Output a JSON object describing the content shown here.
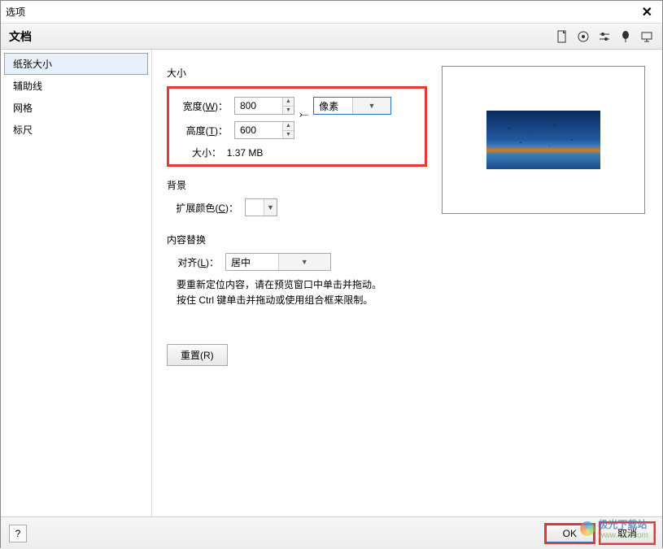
{
  "window": {
    "title": "选项"
  },
  "header": {
    "section": "文档"
  },
  "sidebar": {
    "items": [
      {
        "label": "纸张大小",
        "selected": true
      },
      {
        "label": "辅助线",
        "selected": false
      },
      {
        "label": "网格",
        "selected": false
      },
      {
        "label": "标尺",
        "selected": false
      }
    ]
  },
  "size_group": {
    "title": "大小",
    "width_label_pre": "宽度(",
    "width_label_key": "W",
    "width_label_post": ")：",
    "width_value": "800",
    "height_label_pre": "高度(",
    "height_label_key": "T",
    "height_label_post": ")：",
    "height_value": "600",
    "unit_value": "像素",
    "size_label": "大小：",
    "size_value": "1.37 MB"
  },
  "background_group": {
    "title": "背景",
    "extend_label_pre": "扩展颜色(",
    "extend_label_key": "C",
    "extend_label_post": ")："
  },
  "content_group": {
    "title": "内容替换",
    "align_label_pre": "对齐(",
    "align_label_key": "L",
    "align_label_post": ")：",
    "align_value": "居中",
    "hint1": "要重新定位内容，请在预览窗口中单击并拖动。",
    "hint2": "按住 Ctrl 键单击并拖动或使用组合框来限制。"
  },
  "reset_button": "重置(R)",
  "footer": {
    "help": "?",
    "ok": "OK",
    "cancel": "取消"
  },
  "watermark": {
    "text": "极光下载站",
    "sub": "www.x27.com"
  }
}
